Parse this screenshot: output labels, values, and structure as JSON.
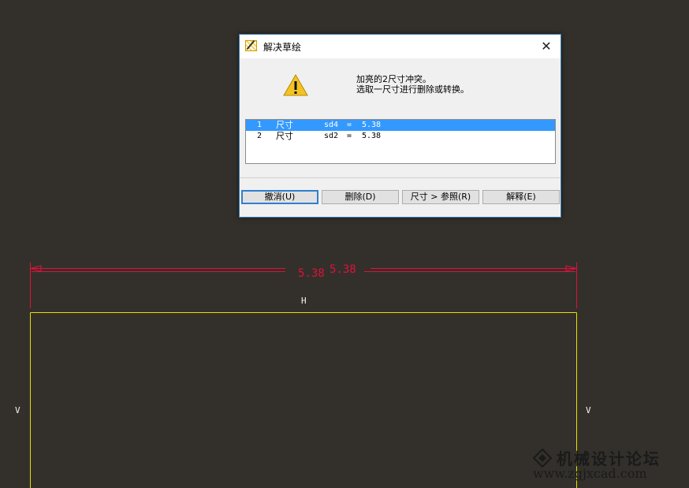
{
  "dialog": {
    "title": "解决草绘",
    "message_line1": "加亮的2尺寸冲突。",
    "message_line2": "选取一尺寸进行删除或转换。",
    "list": [
      {
        "index": "1",
        "type": "尺寸",
        "name": "sd4",
        "eq": "=",
        "value": "5.38",
        "selected": true
      },
      {
        "index": "2",
        "type": "尺寸",
        "name": "sd2",
        "eq": "=",
        "value": "5.38",
        "selected": false
      }
    ],
    "buttons": {
      "undo": "撤消(U)",
      "delete": "删除(D)",
      "to_reference": "尺寸 > 参照(R)",
      "explain": "解释(E)"
    }
  },
  "sketch": {
    "dim_text_1": "5.38",
    "dim_text_2": "5.38",
    "horizontal_constraint": "H",
    "vertical_constraint_left": "V",
    "vertical_constraint_right": "V",
    "colors": {
      "background": "#33302b",
      "dimension": "#e0103c",
      "geometry": "#e8e000",
      "constraint": "#f2f2f2"
    }
  },
  "watermark": {
    "title": "机械设计论坛",
    "url": "www.zgjxcad.com"
  }
}
